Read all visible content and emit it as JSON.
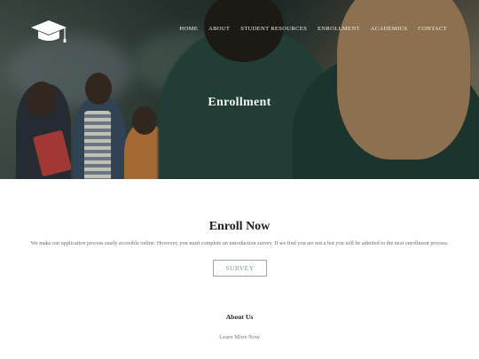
{
  "site": {
    "logo_icon": "graduation-cap-icon",
    "colors": {
      "accent": "#7f9e86",
      "hero_overlay": "#1c2b26"
    }
  },
  "nav": {
    "items": [
      {
        "label": "HOME"
      },
      {
        "label": "ABOUT"
      },
      {
        "label": "STUDENT RESOURCES"
      },
      {
        "label": "ENROLLMENT"
      },
      {
        "label": "ACADEMICS"
      },
      {
        "label": "CONTACT"
      }
    ]
  },
  "hero": {
    "title": "Enrollment"
  },
  "enroll": {
    "heading": "Enroll Now",
    "description": "We make our application process easily accesible online. However, you must complete an introduction survey. If we find you are not a bot you will be admited to the next enrollment process.",
    "button_label": "SURVEY"
  },
  "about": {
    "heading": "About Us",
    "link_label": "Learn More Now"
  }
}
